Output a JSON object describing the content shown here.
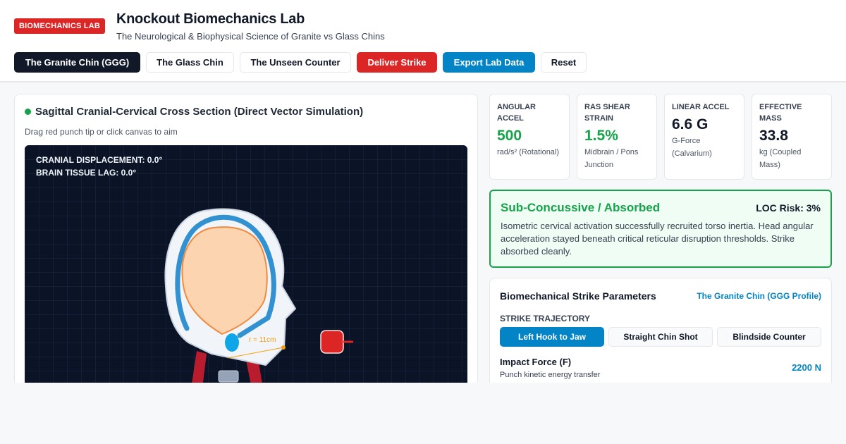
{
  "header": {
    "badge": "BIOMECHANICS LAB",
    "title": "Knockout Biomechanics Lab",
    "subtitle": "The Neurological & Biophysical Science of Granite vs Glass Chins"
  },
  "toolbar": {
    "buttons": [
      {
        "label": "The Granite Chin (GGG)"
      },
      {
        "label": "The Glass Chin"
      },
      {
        "label": "The Unseen Counter"
      },
      {
        "label": "Deliver Strike"
      },
      {
        "label": "Export Lab Data"
      },
      {
        "label": "Reset"
      }
    ]
  },
  "simulation": {
    "title": "Sagittal Cranial-Cervical Cross Section (Direct Vector Simulation)",
    "hint": "Drag red punch tip or click canvas to aim",
    "cranial_displacement": "CRANIAL DISPLACEMENT: 0.0°",
    "brain_tissue_lag": "BRAIN TISSUE LAG: 0.0°",
    "radius_label": "r = 11cm"
  },
  "metrics": [
    {
      "label": "ANGULAR ACCEL",
      "value": "500",
      "unit": "rad/s² (Rotational)",
      "color": "#16a34a"
    },
    {
      "label": "RAS SHEAR STRAIN",
      "value": "1.5%",
      "unit": "Midbrain / Pons Junction",
      "color": "#16a34a"
    },
    {
      "label": "LINEAR ACCEL",
      "value": "6.6 G",
      "unit": "G-Force (Calvarium)",
      "color": "#111827"
    },
    {
      "label": "EFFECTIVE MASS",
      "value": "33.8",
      "unit": "kg (Coupled Mass)",
      "color": "#111827"
    }
  ],
  "status": {
    "title": "Sub-Concussive / Absorbed",
    "risk": "LOC Risk: 3%",
    "description": "Isometric cervical activation successfully recruited torso inertia. Head angular acceleration stayed beneath critical reticular disruption thresholds. Strike absorbed cleanly."
  },
  "params": {
    "title": "Biomechanical Strike Parameters",
    "profile": "The Granite Chin (GGG Profile)",
    "section_label": "STRIKE TRAJECTORY",
    "trajectories": [
      {
        "label": "Left Hook to Jaw",
        "active": true
      },
      {
        "label": "Straight Chin Shot",
        "active": false
      },
      {
        "label": "Blindside Counter",
        "active": false
      }
    ],
    "force_label": "Impact Force (F)",
    "force_sub": "Punch kinetic energy transfer",
    "force_value": "2200 N"
  },
  "colors": {
    "brand_red": "#dc2626",
    "accent_blue": "#0284c7",
    "safe_green": "#16a34a",
    "canvas_bg": "#0b1327"
  }
}
